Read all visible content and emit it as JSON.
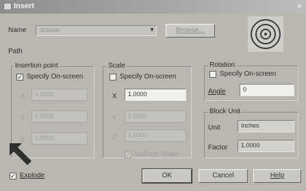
{
  "window": {
    "title": "Insert",
    "close_glyph": "×"
  },
  "name_row": {
    "label": "Name",
    "value": "3Dbottle",
    "browse_label": "Browse..."
  },
  "path": {
    "label": "Path"
  },
  "insertion_point": {
    "title": "Insertion point",
    "specify_label": "Specify On-screen",
    "specify_checked": true,
    "x_label": "X",
    "y_label": "Y",
    "z_label": "Z",
    "x": "0.0000",
    "y": "0.0000",
    "z": "0.0000"
  },
  "scale": {
    "title": "Scale",
    "specify_label": "Specify On-screen",
    "specify_checked": false,
    "x_label": "X",
    "y_label": "Y",
    "z_label": "Z",
    "x": "1.0000",
    "y": "1.0000",
    "z": "1.0000",
    "uniform_label": "Uniform Scale",
    "uniform_checked": true
  },
  "rotation": {
    "title": "Rotation",
    "specify_label": "Specify On-screen",
    "specify_checked": false,
    "angle_label": "Angle",
    "angle": "0"
  },
  "block_unit": {
    "title": "Block Unit",
    "unit_label": "Unit",
    "unit": "Inches",
    "factor_label": "Factor",
    "factor": "1.0000"
  },
  "explode": {
    "label": "Explode",
    "checked": true
  },
  "buttons": {
    "ok": "OK",
    "cancel": "Cancel",
    "help": "Help"
  },
  "icons": {
    "preview": "block-preview-icon",
    "pointer": "arrow-pointer-icon"
  },
  "colors": {
    "dialog_bg": "#b9b7b0",
    "title_bar": "#9a9a9a",
    "field_bg": "#f1f1ec"
  }
}
